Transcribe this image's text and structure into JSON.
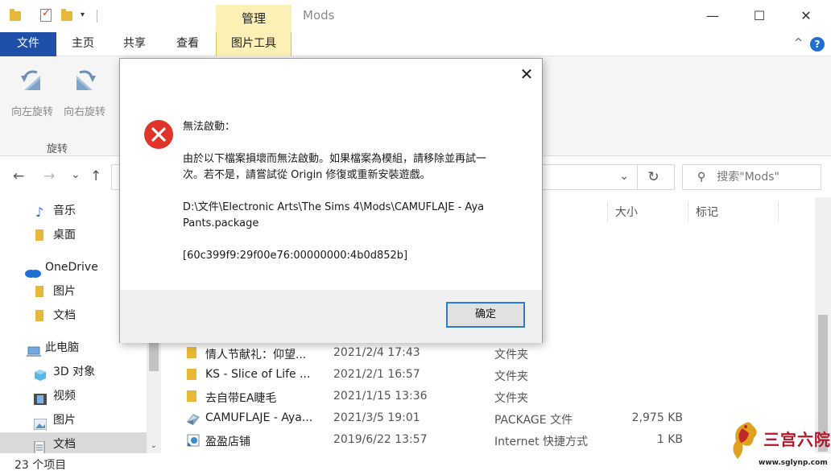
{
  "window": {
    "title": "Mods",
    "context_tab_top": "管理",
    "minimize": "—",
    "maximize": "☐",
    "close": "✕"
  },
  "ribbon": {
    "tabs": [
      "文件",
      "主页",
      "共享",
      "查看",
      "图片工具"
    ],
    "collapse_glyph": "^",
    "help_glyph": "?",
    "rotate_left": "向左旋转",
    "rotate_right": "向右旋转",
    "group_label": "旋转"
  },
  "address": {
    "back": "←",
    "forward": "→",
    "recent": "⌄",
    "up": "↑",
    "dropdown": "⌄",
    "refresh": "↻",
    "search_placeholder": "搜索\"Mods\"",
    "search_icon": "search-icon"
  },
  "sidebar": {
    "items": [
      {
        "label": "音乐",
        "icon": "music-icon"
      },
      {
        "label": "桌面",
        "icon": "folder-icon"
      },
      {
        "label": "OneDrive",
        "icon": "cloud-icon"
      },
      {
        "label": "图片",
        "icon": "folder-icon"
      },
      {
        "label": "文档",
        "icon": "folder-icon"
      },
      {
        "label": "此电脑",
        "icon": "computer-icon"
      },
      {
        "label": "3D 对象",
        "icon": "cube-icon"
      },
      {
        "label": "视频",
        "icon": "film-icon"
      },
      {
        "label": "图片",
        "icon": "picture-icon"
      },
      {
        "label": "文档",
        "icon": "document-icon"
      }
    ],
    "scroll_down": "⌄"
  },
  "columns": {
    "size": "大小",
    "tags": "标记"
  },
  "files": [
    {
      "name": "情人节献礼：仰望...",
      "date": "2021/2/4 17:43",
      "type": "文件夹",
      "size": "",
      "icon": "folder-icon"
    },
    {
      "name": "KS - Slice of Life ...",
      "date": "2021/2/1 16:57",
      "type": "文件夹",
      "size": "",
      "icon": "folder-icon"
    },
    {
      "name": "去自带EA睫毛",
      "date": "2021/1/15 13:36",
      "type": "文件夹",
      "size": "",
      "icon": "folder-icon"
    },
    {
      "name": "CAMUFLAJE - Aya...",
      "date": "2021/3/5 19:01",
      "type": "PACKAGE 文件",
      "size": "2,975 KB",
      "icon": "package-file-icon"
    },
    {
      "name": "盈盈店铺",
      "date": "2019/6/22 13:57",
      "type": "Internet 快捷方式",
      "size": "1 KB",
      "icon": "internet-shortcut-icon"
    }
  ],
  "status": {
    "item_count": "23 个项目"
  },
  "watermark": {
    "text": "三宫六院",
    "url": "www.sglynp.com"
  },
  "dialog": {
    "close": "✕",
    "heading": "無法啟動：",
    "message_line1": "由於以下檔案損壞而無法啟動。如果檔案為模組，請移除並再試一",
    "message_line2": "次。若不是，請嘗試從 Origin 修復或重新安裝遊戲。",
    "path_line1": "D:\\文件\\Electronic Arts\\The Sims 4\\Mods\\CAMUFLAJE - Aya",
    "path_line2": "Pants.package",
    "error_code": "[60c399f9:29f00e76:00000000:4b0d852b]",
    "ok_label": "确定",
    "colors": {
      "error": "#e0342a",
      "accent": "#2a7ad5"
    }
  }
}
